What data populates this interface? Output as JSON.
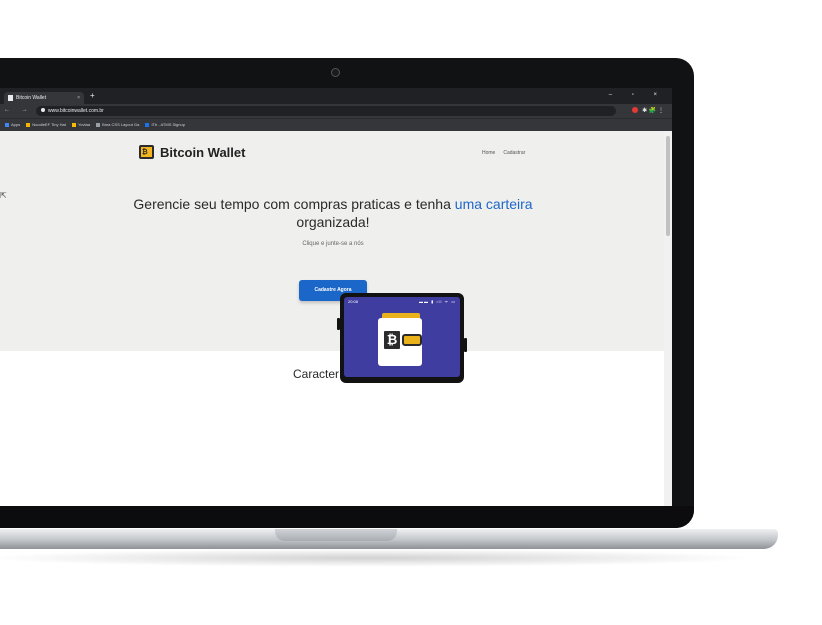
{
  "browser": {
    "tab_title": "Bitcoin Wallet",
    "tab_close": "×",
    "new_tab": "+",
    "window_controls": "–  ▫  ×",
    "nav_buttons": "← → C",
    "url": "www.bitcoinwallet.com.br",
    "extensions": "✱ 🧩 ⋮",
    "bookmarks": [
      "Apps",
      "NoodleEF Tiny Hat",
      "Yovtaa",
      "Bma CSS Layout Ga",
      "ITb - ATMS Signup"
    ]
  },
  "page": {
    "logo_text": "Bitcoin Wallet",
    "logo_icon_glyph": "₿",
    "nav": [
      "Home",
      "Cadastrar"
    ],
    "headline_part1": "Gerencie seu tempo com compras praticas e tenha ",
    "headline_highlight": "uma carteira",
    "headline_part2": "organizada!",
    "subtext": "Clique e junte-se a nós",
    "cta_label": "Cadastre Agora",
    "features_title": "Características",
    "phone_time": "20:08",
    "phone_status": "▬▬ ▮ ıll ᯤ ▭",
    "wallet_glyph": "₿"
  },
  "colors": {
    "accent": "#1f67c8",
    "cta": "#1a66c9",
    "hero_bg": "#efefee",
    "phone_screen": "#3f3da0",
    "wallet_gold": "#e9b21a"
  }
}
